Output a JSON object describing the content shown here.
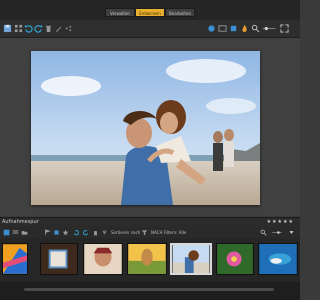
{
  "mode_tabs": [
    "Verwalten",
    "Entwickeln",
    "Bearbeiten"
  ],
  "filmstrip_panel": {
    "title": "Aufnahmespur",
    "rating_stars": "★★★★★",
    "sort_label": "Sortieren nach",
    "filter_label": "NACH Filtern: Alle"
  },
  "colors": {
    "accent": "#e9b02f",
    "toolbar": "#2e2e2e",
    "workspace": "#404040",
    "filmstrip": "#262626"
  }
}
